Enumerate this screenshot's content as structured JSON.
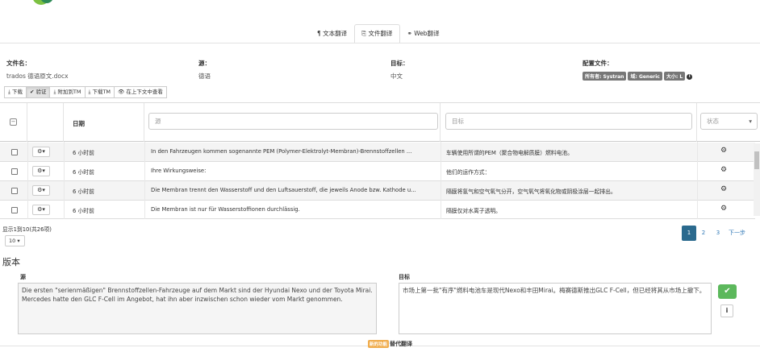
{
  "tabs": [
    {
      "icon": "paragraph-icon",
      "label": "¶ 文本翻译"
    },
    {
      "icon": "file-icon",
      "label": "⎘ 文件翻译"
    },
    {
      "icon": "link-icon",
      "label": "⚭ Web翻译"
    }
  ],
  "info": {
    "file_label": "文件名：",
    "file_value": "trados 德语原文.docx",
    "source_label": "源：",
    "source_value": "德语",
    "target_label": "目标：",
    "target_value": "中文",
    "config_label": "配置文件：",
    "badges": [
      "所有者: Systran",
      "域: Generic",
      "大小: L"
    ]
  },
  "toolbar": {
    "download": "⤓ 下载",
    "validate": "✔ 验证",
    "add_tm": "⤓ 附加到TM",
    "download_tm": "⤓ 下载TM",
    "view_context": "👁 在上下文中查看"
  },
  "grid": {
    "header_date": "日期",
    "filter_source_placeholder": "源",
    "filter_target_placeholder": "目标",
    "status_select": "状态",
    "rows": [
      {
        "date": "6 小时前",
        "source": "In den Fahrzeugen kommen sogenannte PEM (Polymer-Elektrolyt-Membran)-Brennstoffzellen ...",
        "target": "车辆使用所谓的PEM（聚合物电解质膜）燃料电池。"
      },
      {
        "date": "6 小时前",
        "source": "Ihre Wirkungsweise:",
        "target": "他们的运作方式："
      },
      {
        "date": "6 小时前",
        "source": "Die Membran trennt den Wasserstoff und den Luftsauerstoff, die jeweils Anode bzw. Kathode u...",
        "target": "隔膜将氢气和空气氧气分开，空气氧气将氧化物或阴极涂层一起排出。"
      },
      {
        "date": "6 小时前",
        "source": "Die Membran ist nur für Wasserstoffionen durchlässig.",
        "target": "隔膜仅对水离子透明。"
      }
    ]
  },
  "footer_grid": {
    "showing": "显示1到10(共26项)",
    "page_size": "10 ▾",
    "pages": [
      "1",
      "2",
      "3",
      "下一步"
    ]
  },
  "version": {
    "title": "版本",
    "source_label": "源",
    "target_label": "目标",
    "source_text": "Die ersten \"serienmäßigen\" Brennstoffzellen-Fahrzeuge auf dem Markt sind der Hyundai Nexo und der Toyota Mirai. Mercedes hatte den GLC F-Cell im Angebot, hat ihn aber inzwischen schon wieder vom Markt genommen.",
    "target_text": "市场上第一批\"有序\"燃料电池车是现代Nexo和丰田Mirai。梅赛德斯推出GLC F-Cell，但已经将其从市场上撤下。"
  },
  "footer": {
    "new_badge": "新的功能",
    "alt_translation": "替代翻译"
  },
  "colors": {
    "primary": "#2b6a8e",
    "success": "#5cb85c",
    "badge": "#777777",
    "new": "#f0ad4e"
  }
}
